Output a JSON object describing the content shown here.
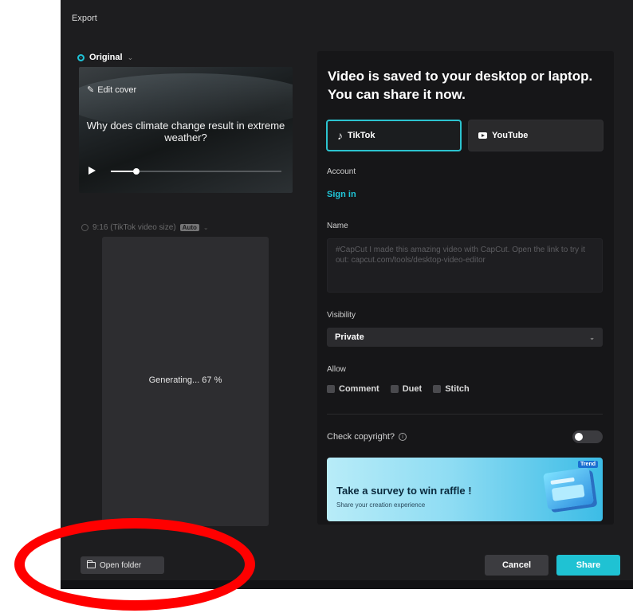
{
  "window": {
    "title": "Export"
  },
  "left": {
    "original_label": "Original",
    "edit_cover_label": "Edit cover",
    "video_caption": "Why does climate change result in extreme weather?",
    "playback_progress": 0.15,
    "size_option_label": "9:16 (TikTok video size)",
    "size_option_badge": "Auto",
    "generating_text": "Generating... 67 %"
  },
  "panel": {
    "heading": "Video is saved to your desktop or laptop. You can share it now.",
    "tabs": [
      {
        "label": "TikTok",
        "icon": "tiktok-icon",
        "selected": true
      },
      {
        "label": "YouTube",
        "icon": "youtube-icon",
        "selected": false
      }
    ],
    "account_label": "Account",
    "sign_in_label": "Sign in",
    "name_label": "Name",
    "name_placeholder": "#CapCut I made this amazing video with CapCut. Open the link to try it out: capcut.com/tools/desktop-video-editor",
    "visibility_label": "Visibility",
    "visibility_value": "Private",
    "allow_label": "Allow",
    "allow_options": [
      "Comment",
      "Duet",
      "Stitch"
    ],
    "copyright_label": "Check copyright?",
    "copyright_enabled": false,
    "banner": {
      "title": "Take a survey to win raffle !",
      "subtitle": "Share your creation experience",
      "badge": "Trend"
    }
  },
  "footer": {
    "open_folder_label": "Open folder",
    "cancel_label": "Cancel",
    "share_label": "Share"
  },
  "colors": {
    "accent": "#1fc2d3",
    "annotation": "#ff0000"
  }
}
